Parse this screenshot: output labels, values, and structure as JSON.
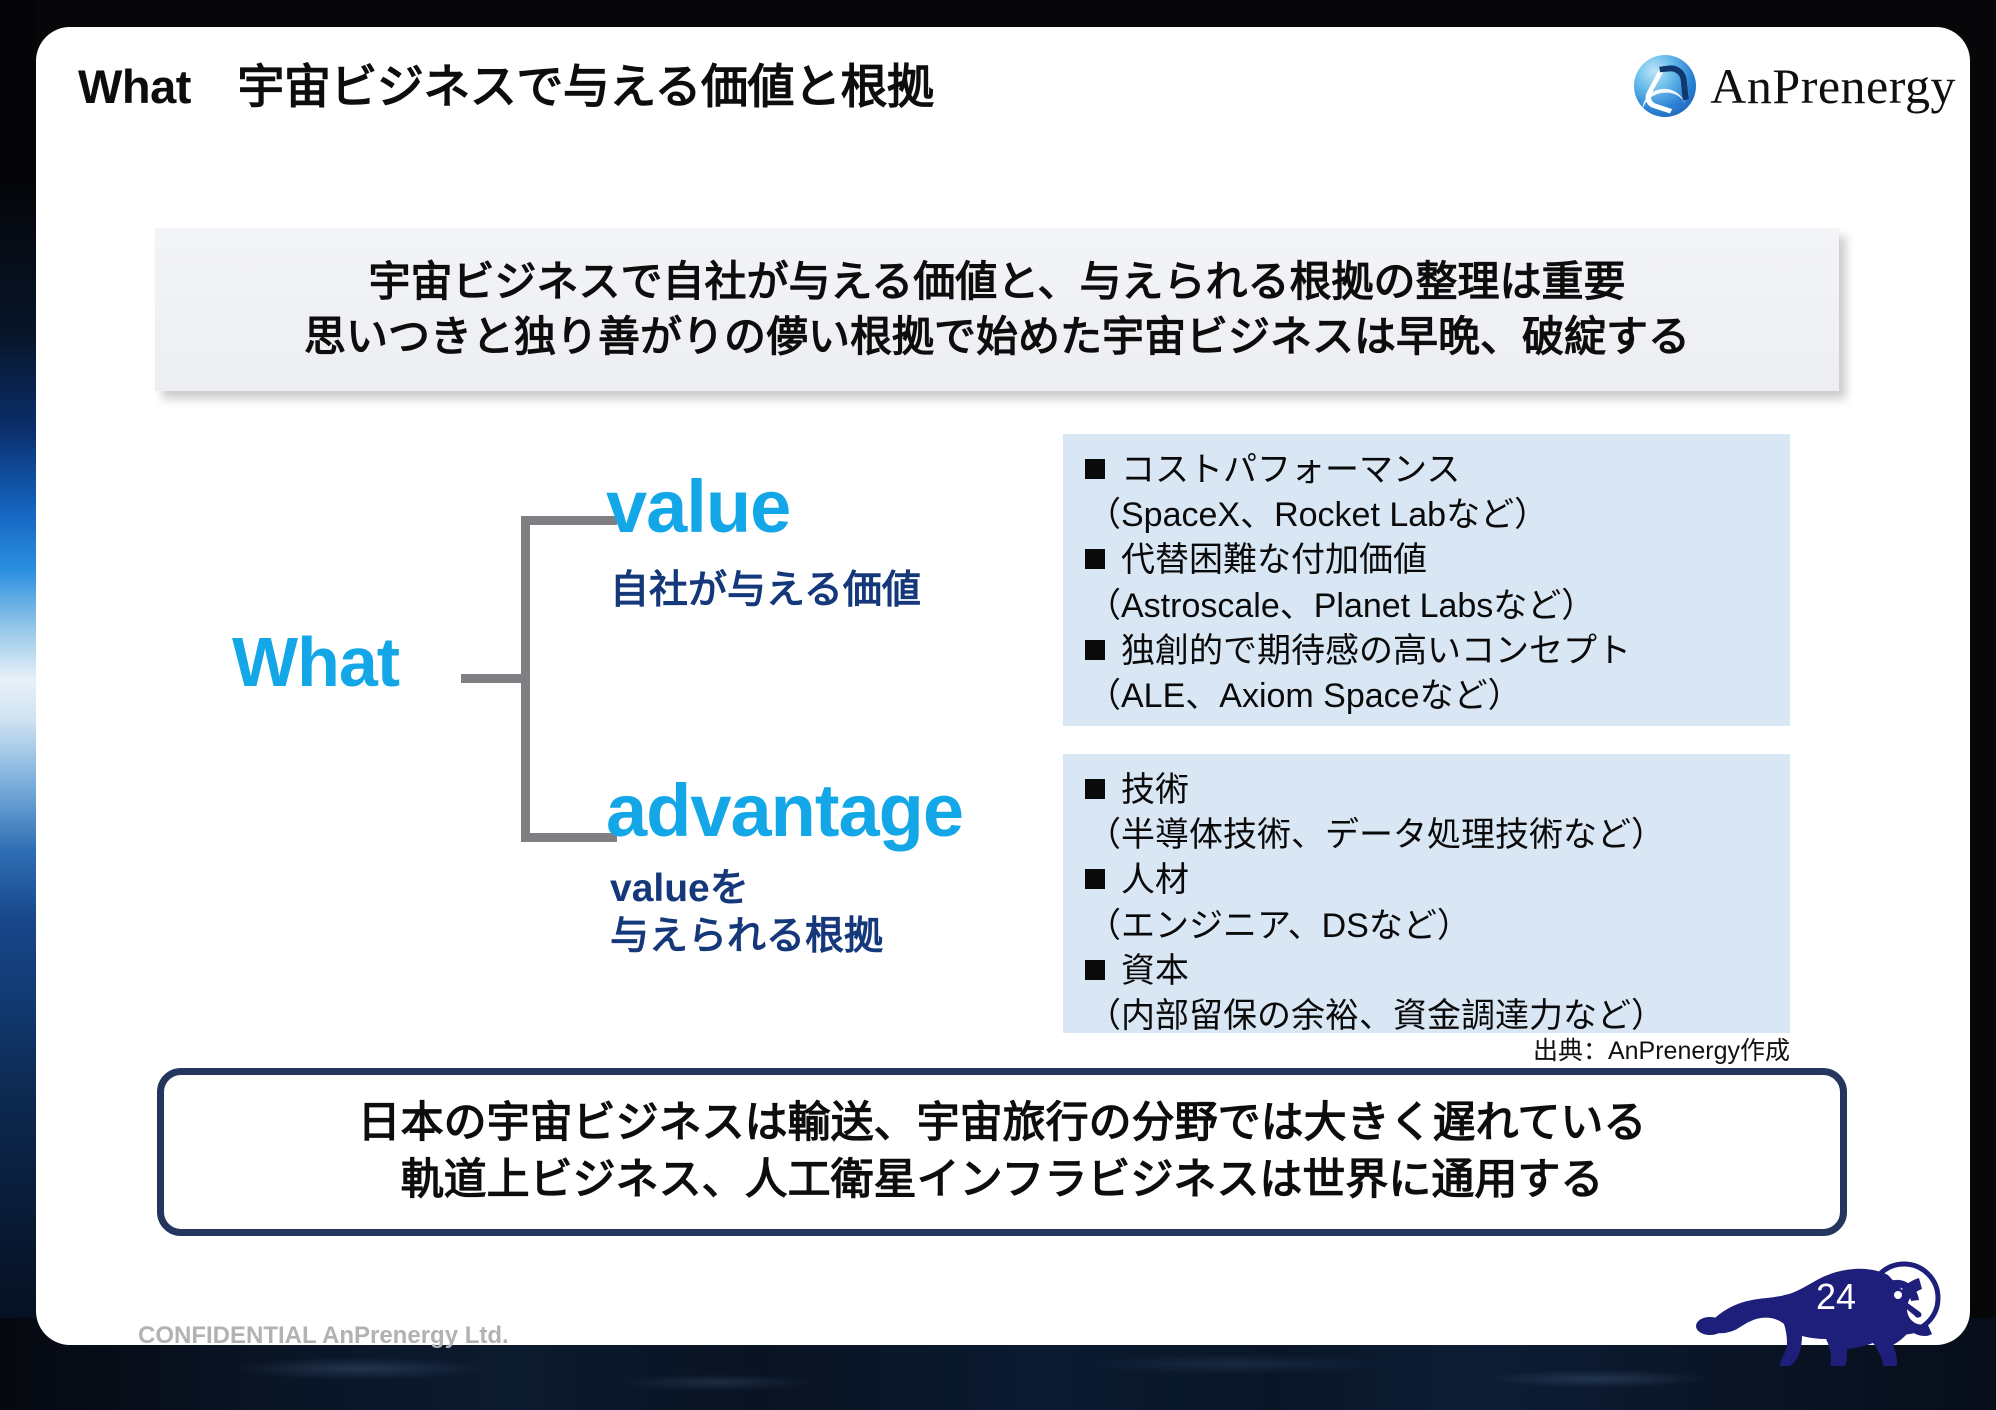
{
  "header": {
    "title": "What　宇宙ビジネスで与える価値と根拠",
    "logo_text": "AnPrenergy"
  },
  "top_message": {
    "line1": "宇宙ビジネスで自社が与える価値と、与えられる根拠の整理は重要",
    "line2": "思いつきと独り善がりの儚い根拠で始めた宇宙ビジネスは早晩、破綻する"
  },
  "diagram": {
    "root": "What",
    "branches": [
      {
        "title": "value",
        "subtitle": "自社が与える価値"
      },
      {
        "title": "advantage",
        "subtitle_line1": "valueを",
        "subtitle_line2": "与えられる根拠"
      }
    ]
  },
  "value_box": {
    "items": [
      {
        "head": "コストパフォーマンス",
        "note": "（SpaceX、Rocket Labなど）"
      },
      {
        "head": "代替困難な付加価値",
        "note": "（Astroscale、Planet Labsなど）"
      },
      {
        "head": "独創的で期待感の高いコンセプト",
        "note": "（ALE、Axiom Spaceなど）"
      }
    ]
  },
  "advantage_box": {
    "items": [
      {
        "head": "技術",
        "note": "（半導体技術、データ処理技術など）"
      },
      {
        "head": "人材",
        "note": "（エンジニア、DSなど）"
      },
      {
        "head": "資本",
        "note": "（内部留保の余裕、資金調達力など）"
      }
    ]
  },
  "source_note": "出典：AnPrenergy作成",
  "bottom_message": {
    "line1": "日本の宇宙ビジネスは輸送、宇宙旅行の分野では大きく遅れている",
    "line2": "軌道上ビジネス、人工衛星インフラビジネスは世界に通用する"
  },
  "footer": {
    "confidential": "CONFIDENTIAL AnPrenergy Ltd.",
    "page_number": "24"
  },
  "colors": {
    "accent_cyan": "#14a7e8",
    "navy": "#15387a",
    "box_blue": "#d9e6f4",
    "border_navy": "#25365e",
    "gray_box": "#eceef2"
  }
}
